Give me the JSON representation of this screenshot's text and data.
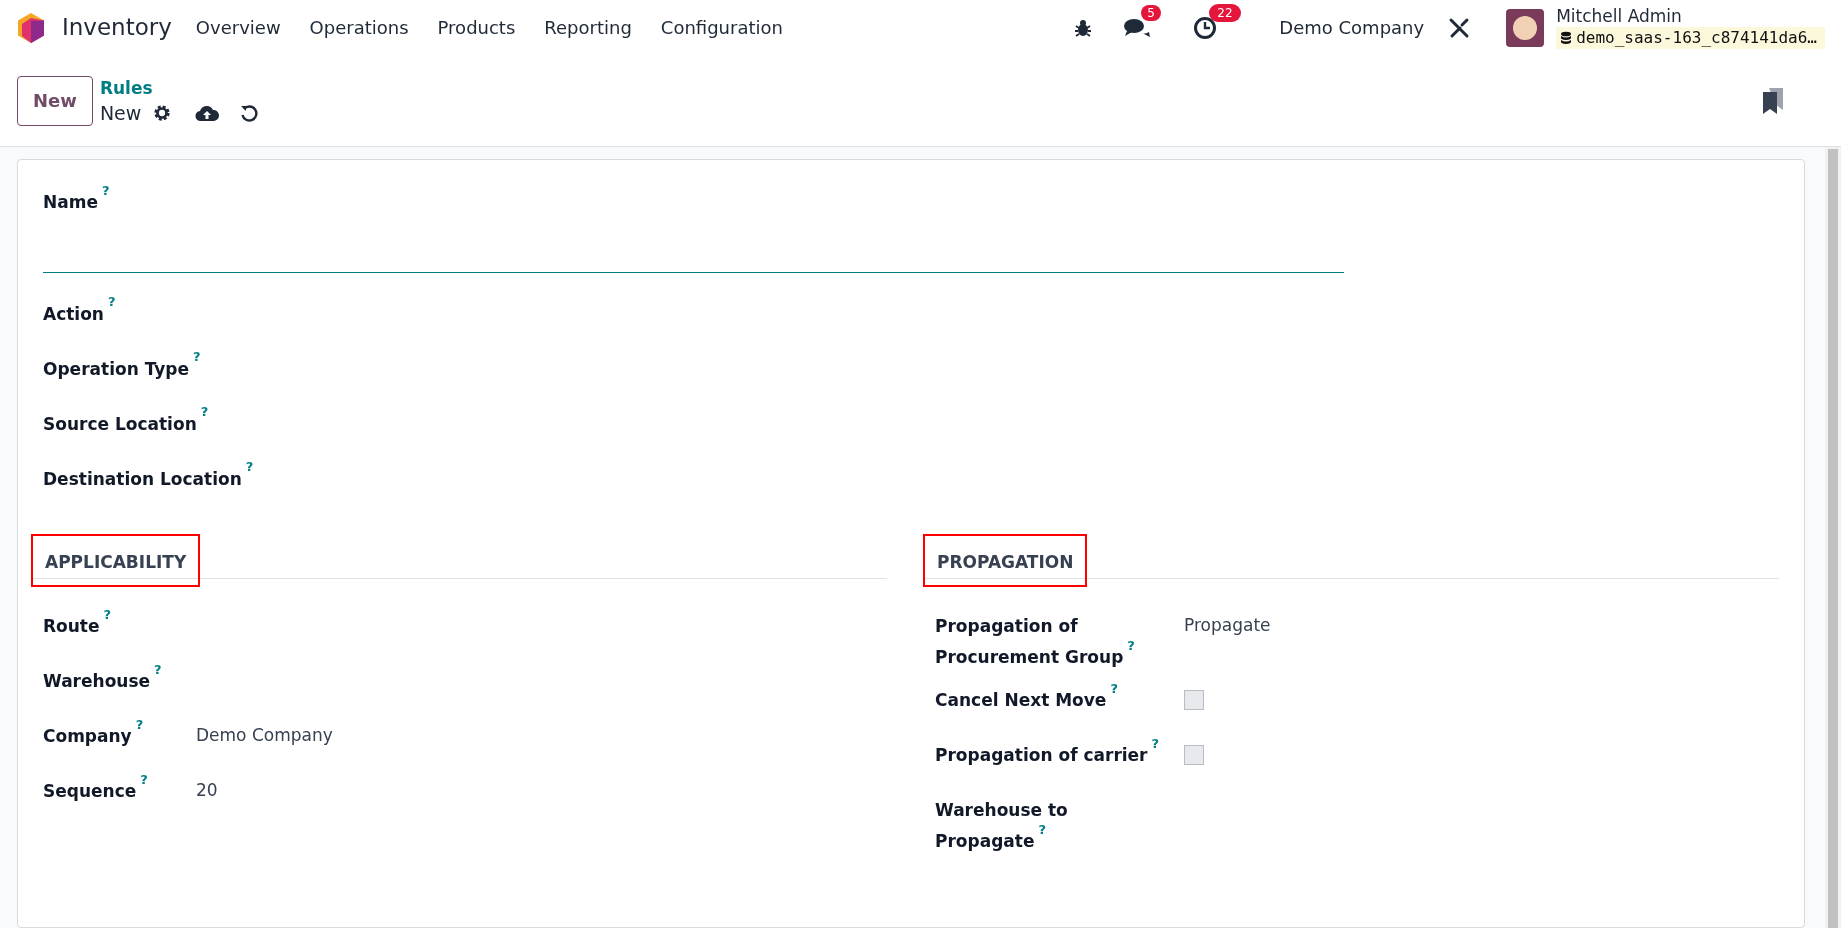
{
  "navbar": {
    "app_name": "Inventory",
    "menu": [
      "Overview",
      "Operations",
      "Products",
      "Reporting",
      "Configuration"
    ],
    "messages_badge": "5",
    "activities_badge": "22",
    "company": "Demo Company",
    "user": {
      "name": "Mitchell Admin",
      "database": "demo_saas-163_c874141da6…"
    }
  },
  "control_panel": {
    "new_button": "New",
    "breadcrumb_parent": "Rules",
    "breadcrumb_current": "New"
  },
  "form": {
    "name_field": {
      "label": "Name",
      "help": "?"
    },
    "top_fields": [
      {
        "label": "Action",
        "help": "?"
      },
      {
        "label": "Operation Type",
        "help": "?"
      },
      {
        "label": "Source Location",
        "help": "?"
      },
      {
        "label": "Destination Location",
        "help": "?"
      }
    ],
    "sections": [
      {
        "title": "APPLICABILITY",
        "highlighted": true,
        "fields": [
          {
            "kind": "text",
            "label": "Route",
            "help": "?"
          },
          {
            "kind": "text",
            "label": "Warehouse",
            "help": "?"
          },
          {
            "kind": "text",
            "label": "Company",
            "help": "?",
            "value": "Demo Company"
          },
          {
            "kind": "text",
            "label": "Sequence",
            "help": "?",
            "value": "20"
          }
        ]
      },
      {
        "title": "PROPAGATION",
        "highlighted": true,
        "fields": [
          {
            "kind": "text",
            "label": "Propagation of Procurement Group",
            "help": "?",
            "value": "Propagate"
          },
          {
            "kind": "checkbox",
            "label": "Cancel Next Move",
            "help": "?",
            "checked": false
          },
          {
            "kind": "checkbox",
            "label": "Propagation of carrier",
            "help": "?",
            "checked": false
          },
          {
            "kind": "text",
            "label": "Warehouse to Propagate",
            "help": "?"
          }
        ]
      }
    ]
  }
}
